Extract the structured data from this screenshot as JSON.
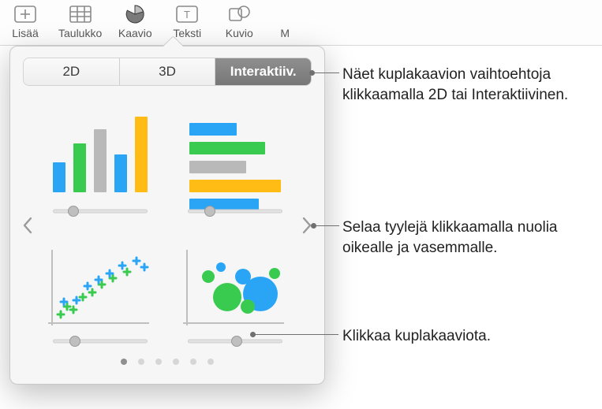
{
  "toolbar": {
    "items": [
      {
        "label": "Lisää"
      },
      {
        "label": "Taulukko"
      },
      {
        "label": "Kaavio"
      },
      {
        "label": "Teksti"
      },
      {
        "label": "Kuvio"
      },
      {
        "label": "M"
      }
    ]
  },
  "segmented": {
    "tabs": {
      "t2d": "2D",
      "t3d": "3D",
      "interactive": "Interaktiiv."
    },
    "selected": "interactive"
  },
  "palette": {
    "blue": "#2AA5F6",
    "green": "#38CB4F",
    "gray": "#B9B9B9",
    "yellow": "#FFBC14"
  },
  "charts": {
    "bar": {
      "values": [
        38,
        62,
        80,
        48,
        96
      ]
    },
    "hbar": {
      "values": [
        60,
        96,
        72,
        116,
        88
      ]
    },
    "scatter": {
      "note": "scatter-plus-marks"
    },
    "bubble": {
      "note": "bubble-chart"
    }
  },
  "sliders": {
    "knob_positions_pct": [
      22,
      24,
      24,
      52
    ]
  },
  "pager": {
    "count": 6,
    "active": 0
  },
  "callouts": {
    "top": "Näet kuplakaavion vaihtoehtoja klikkaamalla 2D tai Interaktiivinen.",
    "mid": "Selaa tyylejä klikkaamalla nuolia oikealle ja vasemmalle.",
    "bottom": "Klikkaa kuplakaaviota."
  }
}
